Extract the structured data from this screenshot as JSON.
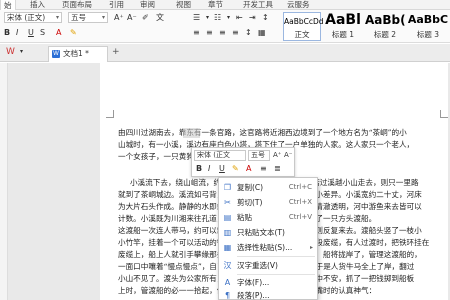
{
  "ribbon_tabs": [
    {
      "label": "始"
    },
    {
      "label": "插入"
    },
    {
      "label": "页面布局"
    },
    {
      "label": "引用"
    },
    {
      "label": "审阅"
    },
    {
      "label": "视图"
    },
    {
      "label": "章节"
    },
    {
      "label": "开发工具"
    },
    {
      "label": "云服务"
    }
  ],
  "font": {
    "name": "宋体 (正文)",
    "size": "五号"
  },
  "styles": [
    {
      "preview": "AaBbCcDd",
      "label": "正文"
    },
    {
      "preview": "AaBl",
      "label": "标题 1"
    },
    {
      "preview": "AaBb(",
      "label": "标题 2"
    },
    {
      "preview": "AaBbC",
      "label": "标题 3"
    }
  ],
  "document_tab": {
    "title": "文档1 *"
  },
  "document_lines": [
    "由四川过湖南去，靠东有一条官路，这官路将近湘西边境到了一个地方名为“茶峒”的小",
    "山城时，有一小溪，溪边有座白色小塔，塔下住了一户单独的人家。这人家只一个老人，",
    "一个女孩子，一只黄狗",
    "",
    "小溪流下去，绕山岨流，约三里便汇入茶峒的大河。人若过溪越小山走去，则只一里路",
    "就到了茶峒城边。溪流如弓背，山路如弓弦，故远近有了小小差异。小溪宽约二十丈，河床",
    "为大片石头作成。静静的水即或深到一篙不能落底，却依然清澈透明，河中游鱼来去皆可以",
    "计数。小溪既为川湘来往孔道，限于财力不能搭桥，就安排了一只方头渡船。",
    "这渡船一次连人带马，约可以载二十位搭客过河，人数多时则反复来去。渡船头竖了一枝小",
    "小竹竿，挂着一个可以活动的铁环，溪岸两端水面横牵了一段废缆，有人过渡时，把铁环挂在",
    "废缆上，船上人就引手攀缘那条缆索，慢慢的牵船过对岸去。船将拢岸了，管理这渡船的，",
    "一面口中嚷着“慢点慢点”，自己霍的跃上了岸，拉着铁环，于是人货牛马全上了岸，翻过",
    "小山不见了。渡头为公家所有，故过渡人不必出钱。有人心中不安，抓了一把钱掷到船板",
    "上时，管渡船的必一一拾起，依然塞到那人手心里，俨然吵嘴时的认真神气："
  ],
  "mini_toolbar": {
    "font": "宋体 (正文",
    "size": "五号",
    "buttons": [
      "B",
      "I",
      "U",
      "A",
      "≡",
      "≣"
    ]
  },
  "context_menu": {
    "items": [
      {
        "label": "复制(C)",
        "shortcut": "Ctrl+C",
        "icon": "copy-icon"
      },
      {
        "label": "剪切(T)",
        "shortcut": "Ctrl+X",
        "icon": "cut-icon"
      },
      {
        "label": "粘贴",
        "shortcut": "Ctrl+V",
        "icon": "paste-icon"
      },
      {
        "label": "只粘贴文本(T)",
        "shortcut": "",
        "icon": "paste-text-icon"
      },
      {
        "label": "选择性粘贴(S)...",
        "shortcut": "",
        "icon": "paste-special-icon"
      },
      {
        "label": "汉字重选(V)",
        "shortcut": "",
        "icon": "reselect-icon"
      },
      {
        "label": "字体(F)...",
        "shortcut": "",
        "icon": "font-icon"
      },
      {
        "label": "段落(P)...",
        "shortcut": "",
        "icon": "paragraph-icon"
      }
    ]
  },
  "colors": {
    "accent": "#2b6fd6",
    "highlight": "#c9c9c9",
    "menu_icon": "#3a6fc4"
  }
}
